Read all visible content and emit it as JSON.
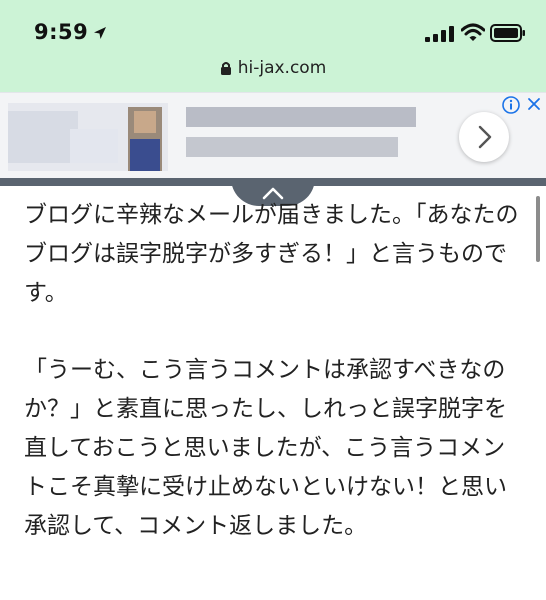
{
  "status_bar": {
    "time": "9:59"
  },
  "browser": {
    "url": "hi-jax.com"
  },
  "icons": {
    "location": "location-arrow-icon",
    "signal": "cellular-signal-icon",
    "wifi": "wifi-icon",
    "battery": "battery-icon",
    "lock": "lock-icon",
    "ad_info": "info-icon",
    "ad_close": "close-icon",
    "ad_arrow": "chevron-right-icon",
    "collapse": "chevron-up-icon"
  },
  "colors": {
    "status_bg": "#ccf3d6",
    "ad_bg": "#f3f4f6",
    "accent_blue": "#1a73e8",
    "bar": "#5a6470"
  },
  "article": {
    "paragraph1": "ブログに辛辣なメールが届きました。「あなたのブログは誤字脱字が多すぎる！」と言うものです。",
    "paragraph2": "「うーむ、こう言うコメントは承認すべきなのか？」と素直に思ったし、しれっと誤字脱字を直しておこうと思いましたが、こう言うコメントこそ真摯に受け止めないといけない！と思い承認して、コメント返しました。"
  }
}
